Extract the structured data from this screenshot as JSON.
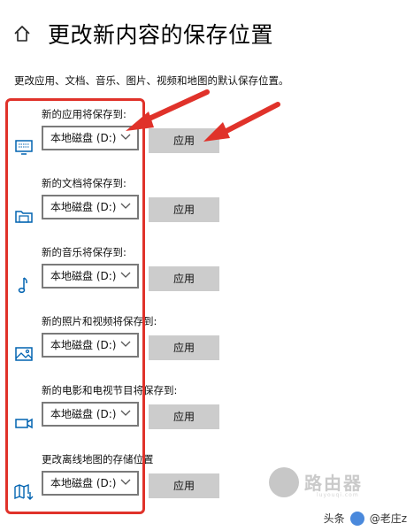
{
  "header": {
    "title": "更改新内容的保存位置",
    "icon": "home-icon"
  },
  "description": "更改应用、文档、音乐、图片、视频和地图的默认保存位置。",
  "sections": [
    {
      "label": "新的应用将保存到:",
      "drive": "本地磁盘 (D:)",
      "apply": "应用",
      "icon": "monitor-icon"
    },
    {
      "label": "新的文档将保存到:",
      "drive": "本地磁盘 (D:)",
      "apply": "应用",
      "icon": "document-folder-icon"
    },
    {
      "label": "新的音乐将保存到:",
      "drive": "本地磁盘 (D:)",
      "apply": "应用",
      "icon": "music-note-icon"
    },
    {
      "label": "新的照片和视频将保存到:",
      "drive": "本地磁盘 (D:)",
      "apply": "应用",
      "icon": "picture-icon"
    },
    {
      "label": "新的电影和电视节目将保存到:",
      "drive": "本地磁盘 (D:)",
      "apply": "应用",
      "icon": "video-camera-icon"
    },
    {
      "label": "更改离线地图的存储位置",
      "drive": "本地磁盘 (D:)",
      "apply": "应用",
      "icon": "map-download-icon"
    }
  ],
  "watermark": {
    "text": "路由器",
    "sub": "luyouqi.com"
  },
  "credit": {
    "source": "头条",
    "author": "@老庄z"
  },
  "colors": {
    "accent": "#0063b1",
    "annotation": "#e0322a",
    "button": "#cccccc"
  }
}
